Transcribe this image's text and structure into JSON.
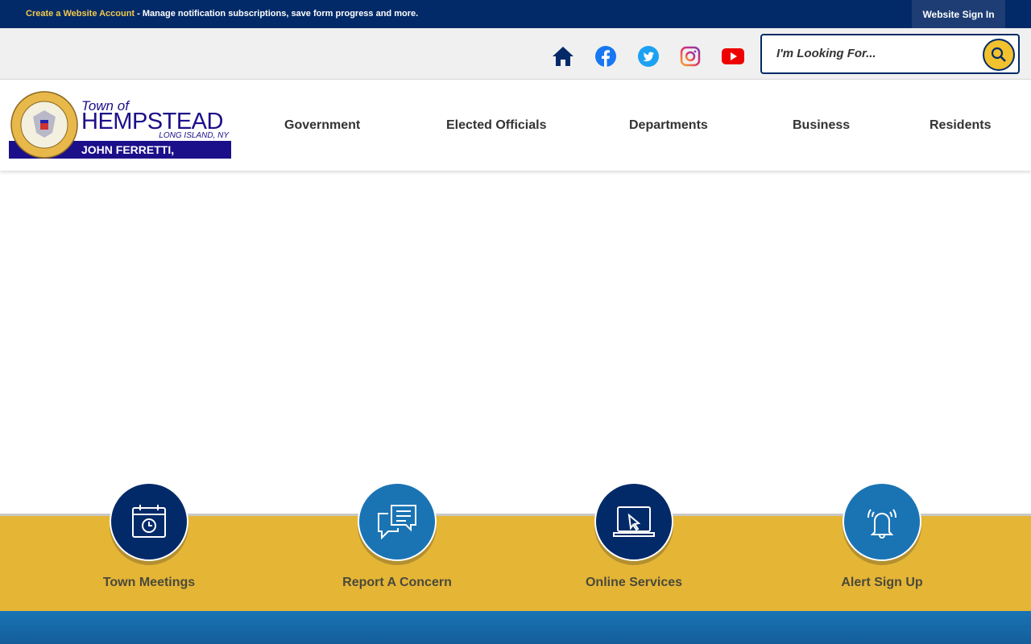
{
  "topbar": {
    "account_link": "Create a Website Account",
    "message": " - Manage notification subscriptions, save form progress and more.",
    "sign_in": "Website Sign In"
  },
  "social": [
    "home-icon",
    "facebook-icon",
    "twitter-icon",
    "instagram-icon",
    "youtube-icon"
  ],
  "search": {
    "placeholder": "I'm Looking For..."
  },
  "logo": {
    "town_of": "Town of",
    "name": "HEMPSTEAD",
    "location": "LONG ISLAND, NY",
    "supervisor": "JOHN FERRETTI, Supervisor"
  },
  "nav": [
    "Government",
    "Elected Officials",
    "Departments",
    "Business",
    "Residents"
  ],
  "quicklinks": [
    {
      "label": "Town Meetings",
      "icon": "calendar-clock-icon",
      "color": "#022a68"
    },
    {
      "label": "Report A Concern",
      "icon": "chat-bubbles-icon",
      "color": "#1a74b4"
    },
    {
      "label": "Online Services",
      "icon": "laptop-cursor-icon",
      "color": "#022a68"
    },
    {
      "label": "Alert Sign Up",
      "icon": "bell-icon",
      "color": "#1a74b4"
    }
  ],
  "colors": {
    "navy": "#022a68",
    "gold": "#e5b536",
    "blue": "#1a74b4"
  }
}
